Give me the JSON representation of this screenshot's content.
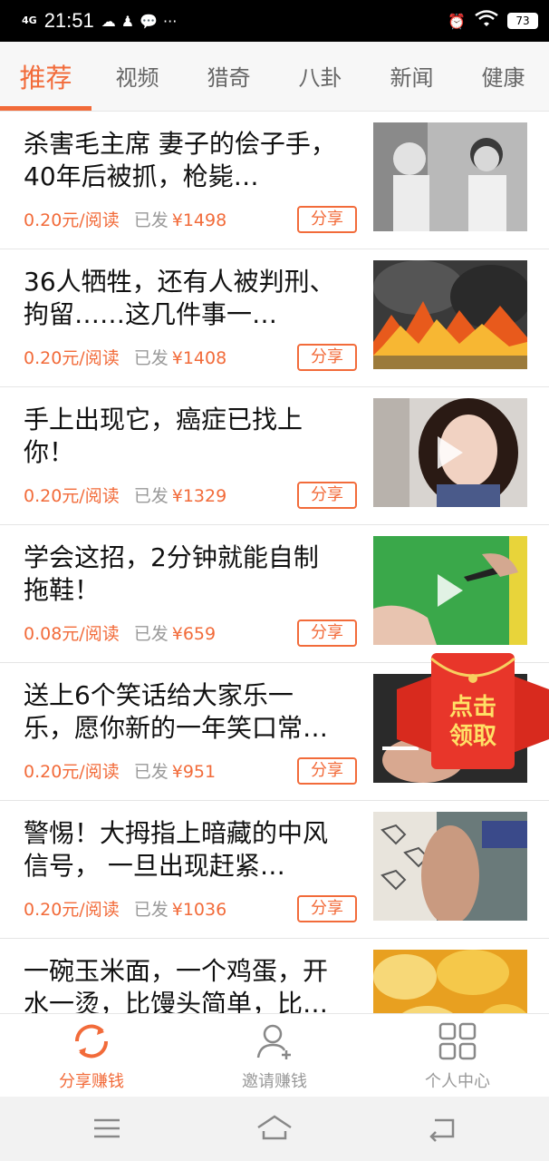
{
  "status_bar": {
    "network": "4G",
    "time": "21:51",
    "battery": "73"
  },
  "tabs": [
    "推荐",
    "视频",
    "猎奇",
    "八卦",
    "新闻",
    "健康"
  ],
  "articles": [
    {
      "title": "杀害毛主席 妻子的侩子手，40年后被抓，枪毙…",
      "rate": "0.20元/阅读",
      "sent_label": "已发",
      "amount": "¥1498",
      "share": "分享",
      "video": false
    },
    {
      "title": "36人牺牲，还有人被判刑、拘留……这几件事一…",
      "rate": "0.20元/阅读",
      "sent_label": "已发",
      "amount": "¥1408",
      "share": "分享",
      "video": false
    },
    {
      "title": "手上出现它，癌症已找上你！",
      "rate": "0.20元/阅读",
      "sent_label": "已发",
      "amount": "¥1329",
      "share": "分享",
      "video": true
    },
    {
      "title": "学会这招，2分钟就能自制拖鞋！",
      "rate": "0.08元/阅读",
      "sent_label": "已发",
      "amount": "¥659",
      "share": "分享",
      "video": true
    },
    {
      "title": "送上6个笑话给大家乐一乐，愿你新的一年笑口常…",
      "rate": "0.20元/阅读",
      "sent_label": "已发",
      "amount": "¥951",
      "share": "分享",
      "video": false
    },
    {
      "title": "警惕！大拇指上暗藏的中风信号， 一旦出现赶紧…",
      "rate": "0.20元/阅读",
      "sent_label": "已发",
      "amount": "¥1036",
      "share": "分享",
      "video": false
    },
    {
      "title": "一碗玉米面，一个鸡蛋，开水一烫，比馒头简单，比…",
      "rate": "",
      "sent_label": "",
      "amount": "",
      "share": "",
      "video": false
    }
  ],
  "red_packet": {
    "line1": "点击",
    "line2": "领取"
  },
  "bottom_nav": [
    "分享赚钱",
    "邀请赚钱",
    "个人中心"
  ]
}
